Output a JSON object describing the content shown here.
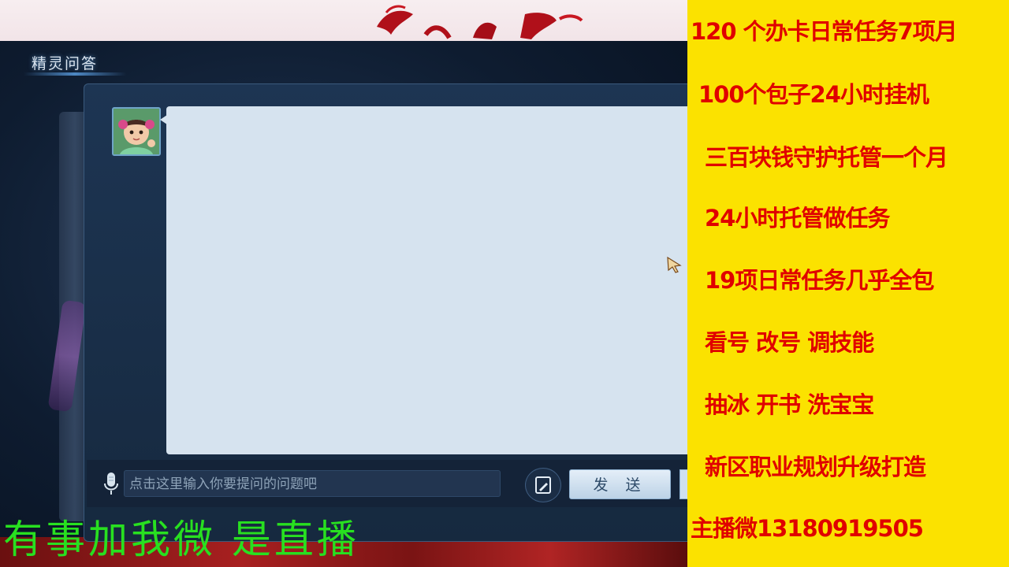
{
  "dialog": {
    "title": "精灵问答",
    "input_placeholder": "点击这里输入你要提问的问题吧",
    "send_label": "发 送"
  },
  "icons": {
    "mic": "microphone-icon",
    "note": "note-edit-icon",
    "cursor": "arrow-cursor-icon",
    "avatar": "girl-avatar"
  },
  "overlay": {
    "caption": "有事加我微 是直播"
  },
  "ad": {
    "lines": [
      "120 个办卡日常任务7项月",
      "100个包子24小时挂机",
      "三百块钱守护托管一个月",
      "24小时托管做任务",
      "19项日常任务几乎全包",
      "看号  改号  调技能",
      "抽冰 开书 洗宝宝",
      "新区职业规划升级打造",
      "主播微13180919505"
    ]
  },
  "colors": {
    "ad_background": "#fbe200",
    "ad_text": "#e00000",
    "caption_text": "#28e020",
    "bubble": "#d6e3ef"
  }
}
